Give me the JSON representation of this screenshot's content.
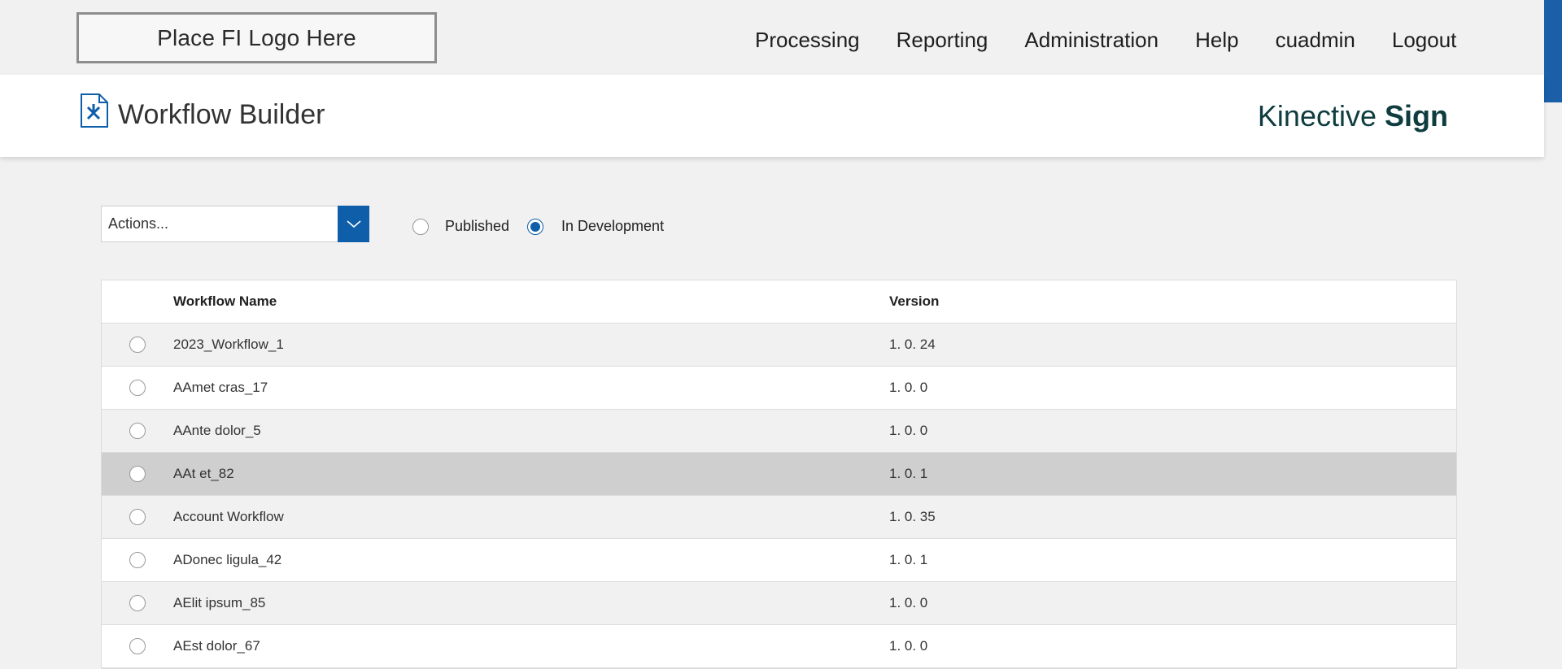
{
  "logo": {
    "text": "Place FI Logo Here"
  },
  "nav": {
    "items": [
      "Processing",
      "Reporting",
      "Administration",
      "Help",
      "cuadmin",
      "Logout"
    ]
  },
  "header": {
    "page_icon": "workflow-tools-icon",
    "title": "Workflow Builder",
    "brand_main": "Kinective ",
    "brand_bold": "Sign"
  },
  "toolbar": {
    "actions_label": "Actions...",
    "actions_icon": "chevron-down-icon"
  },
  "filter": {
    "published_label": "Published",
    "in_development_label": "In Development",
    "selected": "In Development"
  },
  "table": {
    "headers": {
      "name": "Workflow Name",
      "version": "Version"
    },
    "rows": [
      {
        "name": "2023_Workflow_1",
        "version": "1. 0. 24"
      },
      {
        "name": "AAmet cras_17",
        "version": "1. 0. 0"
      },
      {
        "name": "AAnte dolor_5",
        "version": "1. 0. 0"
      },
      {
        "name": "AAt et_82",
        "version": "1. 0. 1"
      },
      {
        "name": "Account Workflow",
        "version": "1. 0. 35"
      },
      {
        "name": "ADonec ligula_42",
        "version": "1. 0. 1"
      },
      {
        "name": "AElit ipsum_85",
        "version": "1. 0. 0"
      },
      {
        "name": "AEst dolor_67",
        "version": "1. 0. 0"
      }
    ]
  },
  "colors": {
    "accent": "#0e5ea9",
    "brand": "#0f3d3f",
    "row_alt": "#f1f1f1",
    "row_hover": "#cfcfcf"
  }
}
